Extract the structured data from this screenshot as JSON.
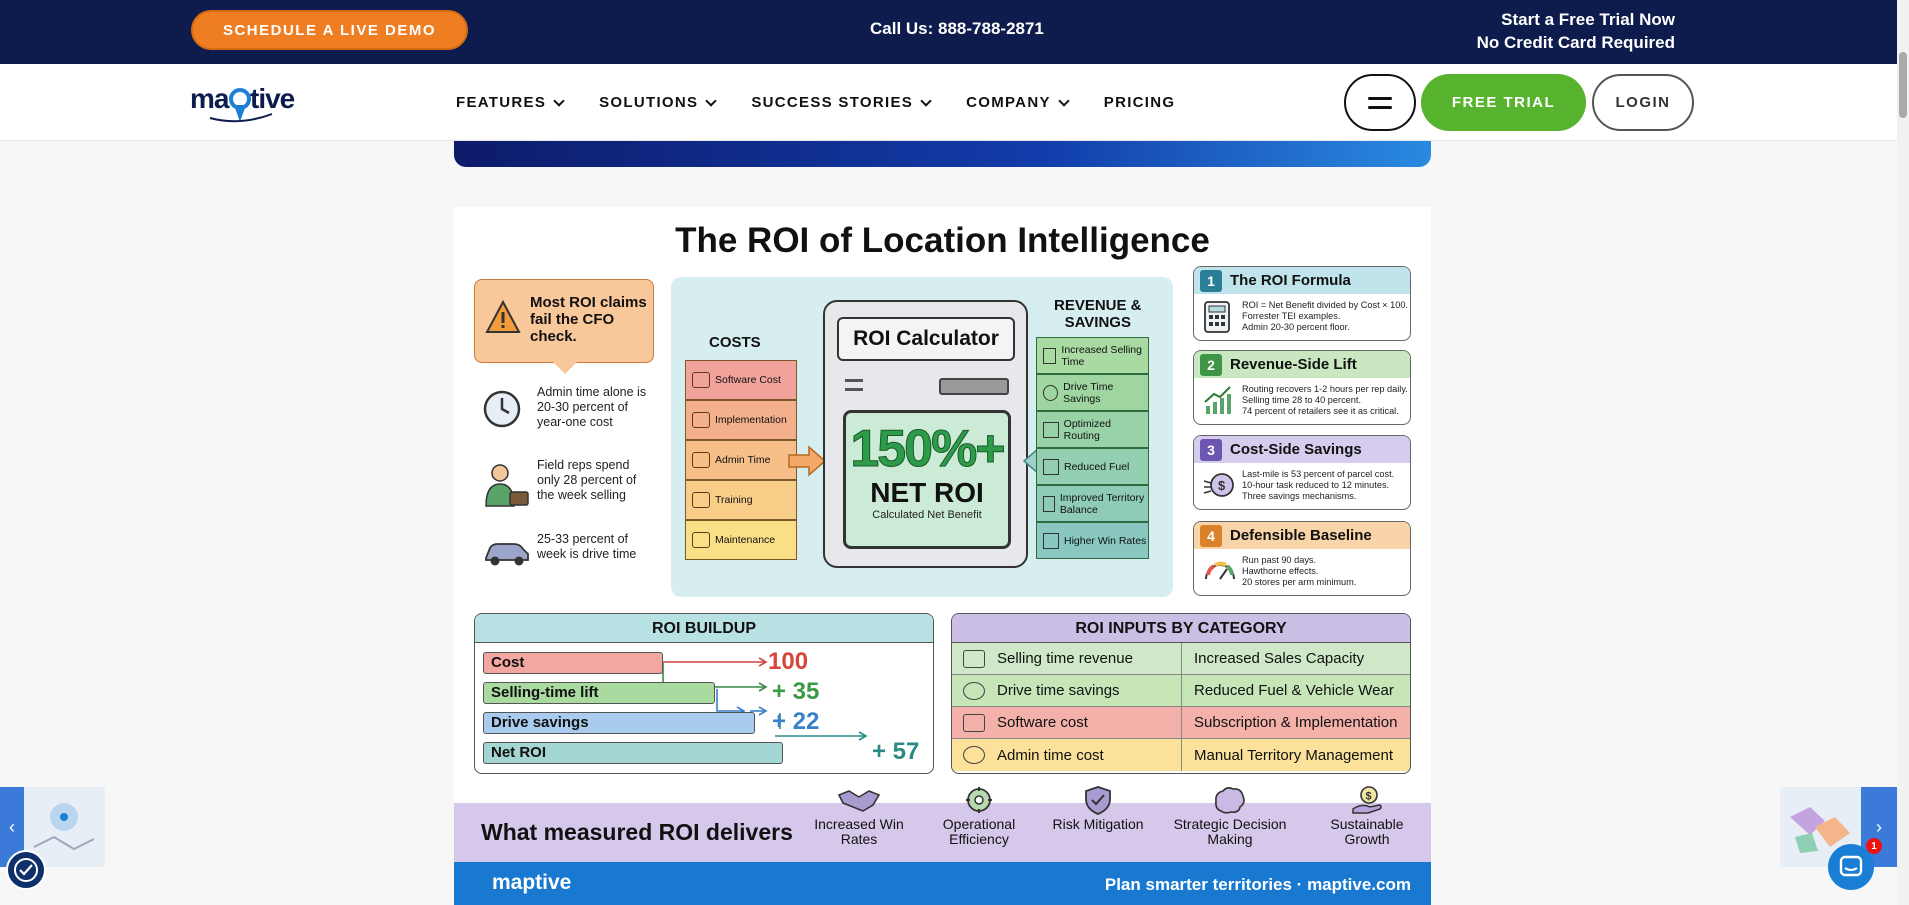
{
  "topbar": {
    "demo_button": "SCHEDULE A LIVE DEMO",
    "phone": "Call Us: 888-788-2871",
    "trial_line1": "Start a Free Trial Now",
    "trial_line2": "No Credit Card Required"
  },
  "nav": {
    "logo": "maptive",
    "items": [
      "FEATURES",
      "SOLUTIONS",
      "SUCCESS STORIES",
      "COMPANY",
      "PRICING"
    ],
    "free_trial": "FREE TRIAL",
    "login": "LOGIN"
  },
  "infographic": {
    "title": "The ROI of Location Intelligence",
    "callout": "Most ROI claims fail the CFO check.",
    "facts": [
      "Admin time alone is 20-30 percent of year-one cost",
      "Field reps spend only 28 percent of the week selling",
      "25-33 percent of week is drive time"
    ],
    "costs_label": "COSTS",
    "costs": [
      "Software Cost",
      "Implementation",
      "Admin Time",
      "Training",
      "Maintenance"
    ],
    "revenue_label_1": "REVENUE &",
    "revenue_label_2": "SAVINGS",
    "revenue": [
      "Increased Selling Time",
      "Drive Time Savings",
      "Optimized Routing",
      "Reduced Fuel",
      "Improved Territory Balance",
      "Higher Win Rates"
    ],
    "calculator": {
      "title": "ROI Calculator",
      "value": "150%+",
      "label": "NET ROI",
      "sub": "Calculated Net Benefit"
    },
    "cards": [
      {
        "num": "1",
        "title": "The ROI Formula",
        "lines": [
          "ROI = Net Benefit divided by Cost × 100.",
          "Forrester TEI examples.",
          "Admin 20-30 percent floor."
        ],
        "color": "#bfe4ec",
        "numcolor": "#2a7f96"
      },
      {
        "num": "2",
        "title": "Revenue-Side Lift",
        "lines": [
          "Routing recovers 1-2 hours per rep daily.",
          "Selling time 28 to 40 percent.",
          "74 percent of retailers see it as critical."
        ],
        "color": "#c9e8c2",
        "numcolor": "#3e9447"
      },
      {
        "num": "3",
        "title": "Cost-Side Savings",
        "lines": [
          "Last-mile is 53 percent of parcel cost.",
          "10-hour task reduced to 12 minutes.",
          "Three savings mechanisms."
        ],
        "color": "#d6cdee",
        "numcolor": "#6d56b0"
      },
      {
        "num": "4",
        "title": "Defensible Baseline",
        "lines": [
          "Run past 90 days.",
          "Hawthorne effects.",
          "20 stores per arm minimum."
        ],
        "color": "#f9d4a8",
        "numcolor": "#d9822b"
      }
    ],
    "buildup": {
      "title": "ROI BUILDUP",
      "rows": [
        {
          "label": "Cost",
          "value": "100",
          "color": "#f2a7a0",
          "vcolor": "#d9453a"
        },
        {
          "label": "Selling-time lift",
          "value": "+ 35",
          "color": "#a9dba0",
          "vcolor": "#3a9a45"
        },
        {
          "label": "Drive savings",
          "value": "+ 22",
          "color": "#a9cbed",
          "vcolor": "#3a7fc8"
        },
        {
          "label": "Net ROI",
          "value": "+ 57",
          "color": "#a3d6d2",
          "vcolor": "#2a8b86"
        }
      ]
    },
    "inputs": {
      "title": "ROI INPUTS BY CATEGORY",
      "rows": [
        {
          "left": "Selling time revenue",
          "right": "Increased Sales Capacity",
          "color": "#cfe9c8"
        },
        {
          "left": "Drive time savings",
          "right": "Reduced Fuel & Vehicle Wear",
          "color": "#c6e6b8"
        },
        {
          "left": "Software cost",
          "right": "Subscription & Implementation",
          "color": "#f3b1aa"
        },
        {
          "left": "Admin time cost",
          "right": "Manual Territory Management",
          "color": "#fbe19a"
        }
      ]
    },
    "delivers": {
      "label": "What measured ROI delivers",
      "items": [
        "Increased Win Rates",
        "Operational Efficiency",
        "Risk Mitigation",
        "Strategic Decision Making",
        "Sustainable Growth"
      ]
    },
    "footer": {
      "logo": "maptive",
      "text": "Plan smarter territories  ·  maptive.com"
    }
  },
  "chat_badge": "1"
}
